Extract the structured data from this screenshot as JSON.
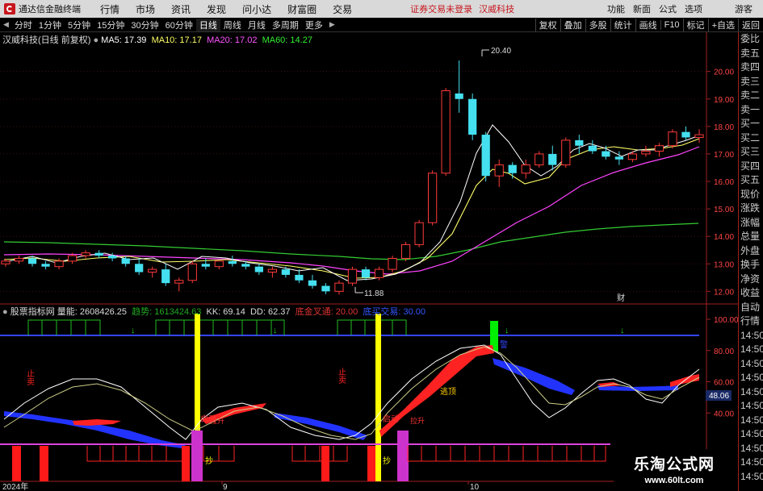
{
  "titlebar": {
    "app_name": "通达信金融终端",
    "menu": [
      "行情",
      "市场",
      "资讯",
      "发现",
      "问小达",
      "财富圈",
      "交易"
    ],
    "notice": "证券交易未登录",
    "stock_name": "汉威科技",
    "right_menu": [
      "功能",
      "新面",
      "公式",
      "选项"
    ],
    "guest": "游客"
  },
  "periodbar": {
    "periods": [
      "分时",
      "1分钟",
      "5分钟",
      "15分钟",
      "30分钟",
      "60分钟",
      "日线",
      "周线",
      "月线",
      "多周期",
      "更多"
    ],
    "active": "日线",
    "tools": [
      "复权",
      "叠加",
      "多股",
      "统计",
      "画线",
      "F10",
      "标记",
      "+自选",
      "返回"
    ]
  },
  "main_legend": {
    "title": "汉威科技(日线 前复权)",
    "ma5": "MA5: 17.39",
    "ma10": "MA10: 17.17",
    "ma20": "MA20: 17.02",
    "ma60": "MA60: 14.27",
    "ma5_color": "#ffffff",
    "ma10_color": "#ffff66",
    "ma20_color": "#ff55ff",
    "ma60_color": "#33ee33"
  },
  "price_axis": [
    "20.00",
    "19.00",
    "18.00",
    "17.00",
    "16.00",
    "15.00",
    "14.00",
    "13.00",
    "12.00"
  ],
  "annotations": {
    "high": "20.40",
    "low": "11.88",
    "cai_mark": "财"
  },
  "indicator_legend": {
    "name": "股票指标网",
    "volume": "量能: 2608426.25",
    "trend": "趋势: 1613424.63",
    "kk": "KK: 69.14",
    "dd": "DD: 62.37",
    "golden": "底金叉通: 20.00",
    "chance": "底买交易: 30.00"
  },
  "ind_axis": [
    "100.00",
    "80.00",
    "60.00",
    "40.00"
  ],
  "ind_value_box": "48.06",
  "ind_labels": {
    "stop1": "止卖",
    "stop2": "止卖",
    "buy1": "抄",
    "buy2": "抄",
    "sell_peak": "逃顶",
    "start1": "启动",
    "start2": "启动",
    "lift1": "拉升",
    "lift2": "拉升",
    "warn": "警"
  },
  "dates": {
    "d1": "2024年",
    "d2": "9",
    "d3": "10"
  },
  "side_panel": [
    "委比",
    "卖五",
    "卖四",
    "卖三",
    "卖二",
    "卖一",
    "买一",
    "买二",
    "买三",
    "买四",
    "买五",
    "现价",
    "涨跌",
    "涨幅",
    "总量",
    "外盘",
    "换手",
    "净资",
    "收益",
    "自动",
    "行情",
    "14:50",
    "14:50",
    "14:50",
    "14:50",
    "14:50",
    "14:50",
    "14:50",
    "14:50",
    "14:50",
    "14:50",
    "14:50"
  ],
  "watermark": {
    "line1": "乐淘公式网",
    "line2": "www.60lt.com"
  },
  "chart_data": {
    "type": "candlestick",
    "title": "汉威科技(日线 前复权)",
    "ylim": [
      11.6,
      20.9
    ],
    "candles": [
      [
        13.0,
        13.2,
        12.9,
        13.1
      ],
      [
        13.1,
        13.3,
        13.0,
        13.2
      ],
      [
        13.2,
        13.3,
        12.9,
        13.0
      ],
      [
        13.0,
        13.1,
        12.8,
        12.9
      ],
      [
        12.9,
        13.2,
        12.8,
        13.1
      ],
      [
        13.1,
        13.4,
        13.0,
        13.3
      ],
      [
        13.3,
        13.5,
        13.2,
        13.4
      ],
      [
        13.4,
        13.5,
        13.2,
        13.3
      ],
      [
        13.3,
        13.4,
        13.1,
        13.2
      ],
      [
        13.2,
        13.3,
        12.9,
        13.0
      ],
      [
        13.0,
        13.2,
        12.6,
        12.7
      ],
      [
        12.7,
        12.9,
        12.5,
        12.8
      ],
      [
        12.8,
        13.0,
        12.2,
        12.3
      ],
      [
        12.3,
        12.5,
        12.0,
        12.4
      ],
      [
        12.4,
        13.1,
        12.3,
        13.0
      ],
      [
        13.0,
        13.2,
        12.8,
        12.9
      ],
      [
        12.9,
        13.1,
        12.8,
        13.1
      ],
      [
        13.1,
        13.3,
        12.9,
        13.0
      ],
      [
        13.0,
        13.1,
        12.8,
        12.9
      ],
      [
        12.9,
        13.0,
        12.6,
        12.7
      ],
      [
        12.7,
        12.9,
        12.5,
        12.8
      ],
      [
        12.8,
        12.9,
        12.5,
        12.6
      ],
      [
        12.6,
        12.8,
        12.3,
        12.4
      ],
      [
        12.4,
        12.6,
        12.1,
        12.2
      ],
      [
        12.2,
        12.3,
        11.9,
        12.0
      ],
      [
        12.0,
        12.4,
        11.88,
        12.3
      ],
      [
        12.3,
        12.9,
        12.2,
        12.8
      ],
      [
        12.8,
        12.9,
        12.4,
        12.5
      ],
      [
        12.5,
        12.9,
        12.4,
        12.8
      ],
      [
        12.8,
        13.3,
        12.7,
        13.2
      ],
      [
        13.2,
        13.8,
        13.1,
        13.7
      ],
      [
        13.7,
        14.6,
        13.6,
        14.5
      ],
      [
        14.5,
        16.4,
        14.4,
        16.3
      ],
      [
        16.3,
        19.4,
        16.2,
        19.3
      ],
      [
        19.2,
        20.4,
        18.5,
        19.0
      ],
      [
        19.0,
        19.2,
        17.5,
        17.7
      ],
      [
        17.7,
        17.8,
        16.0,
        16.2
      ],
      [
        16.2,
        16.8,
        15.8,
        16.6
      ],
      [
        16.6,
        16.7,
        16.1,
        16.3
      ],
      [
        16.3,
        16.8,
        16.1,
        16.6
      ],
      [
        16.6,
        17.1,
        16.5,
        17.0
      ],
      [
        17.0,
        17.3,
        16.4,
        16.6
      ],
      [
        16.6,
        17.6,
        16.5,
        17.5
      ],
      [
        17.5,
        17.7,
        17.0,
        17.3
      ],
      [
        17.3,
        17.5,
        17.0,
        17.1
      ],
      [
        17.1,
        17.3,
        16.8,
        16.9
      ],
      [
        16.9,
        17.1,
        16.6,
        16.8
      ],
      [
        16.8,
        17.1,
        16.7,
        17.0
      ],
      [
        17.0,
        17.3,
        16.9,
        17.1
      ],
      [
        17.1,
        17.4,
        16.9,
        17.3
      ],
      [
        17.3,
        17.9,
        17.2,
        17.8
      ],
      [
        17.8,
        18.0,
        17.5,
        17.6
      ],
      [
        17.6,
        17.9,
        17.4,
        17.7
      ]
    ]
  }
}
